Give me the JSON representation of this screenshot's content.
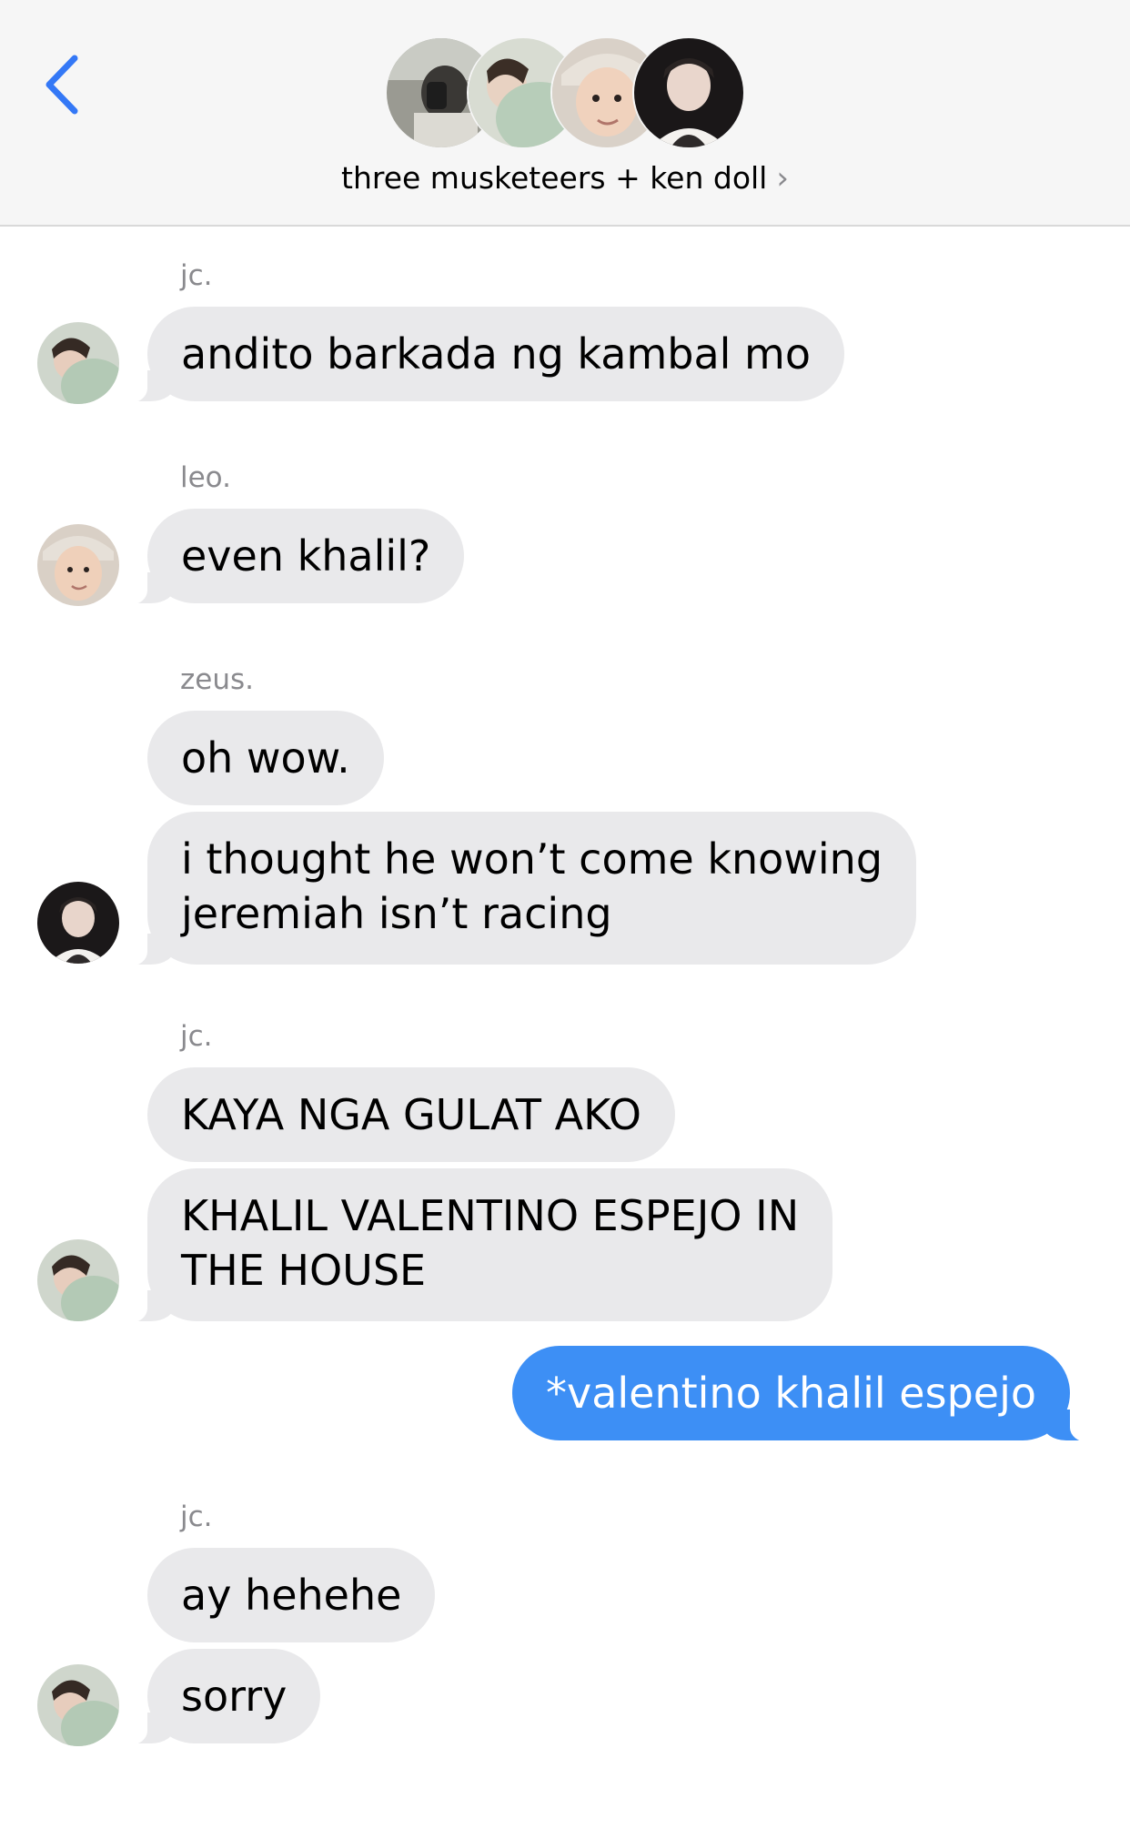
{
  "header": {
    "group_name": "three musketeers + ken doll",
    "chevron": "›",
    "back_icon": "chevron-left-icon",
    "accent": "#3478f6"
  },
  "colors": {
    "incoming_bubble": "#e9e9eb",
    "outgoing_bubble": "#3d8ff5",
    "sender_label": "#8a8a8e"
  },
  "thread": {
    "m1_sender": "jc.",
    "m1_text": "andito barkada ng kambal mo",
    "m2_sender": "leo.",
    "m2_text": "even khalil?",
    "m3_sender": "zeus.",
    "m3_text_1": "oh wow.",
    "m3_text_2_line1": "i thought he won’t come knowing",
    "m3_text_2_line2": "jeremiah isn’t racing",
    "m4_sender": "jc.",
    "m4_text_1": "KAYA NGA GULAT AKO",
    "m4_text_2_line1": "KHALIL VALENTINO ESPEJO IN",
    "m4_text_2_line2": "THE HOUSE",
    "me_text": "*valentino khalil espejo",
    "m5_sender": "jc.",
    "m5_text_1": "ay hehehe",
    "m5_text_2": "sorry"
  }
}
